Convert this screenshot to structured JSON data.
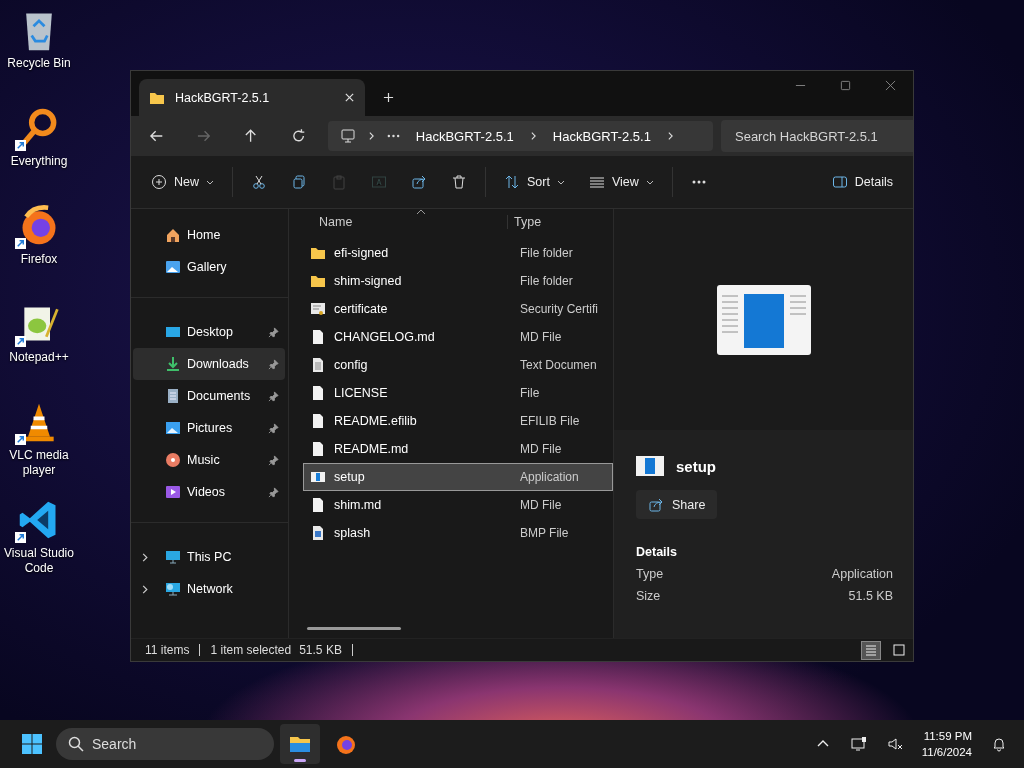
{
  "desktop_icons": [
    {
      "label": "Recycle Bin",
      "kind": "recycle",
      "shortcut": false
    },
    {
      "label": "Everything",
      "kind": "everything",
      "shortcut": true
    },
    {
      "label": "Firefox",
      "kind": "firefox",
      "shortcut": true
    },
    {
      "label": "Notepad++",
      "kind": "notepad",
      "shortcut": true
    },
    {
      "label": "VLC media player",
      "kind": "vlc",
      "shortcut": true
    },
    {
      "label": "Visual Studio Code",
      "kind": "vscode",
      "shortcut": true
    }
  ],
  "window": {
    "tab": {
      "title": "HackBGRT-2.5.1"
    },
    "address": {
      "crumbs": [
        "HackBGRT-2.5.1",
        "HackBGRT-2.5.1"
      ]
    },
    "search": {
      "placeholder": "Search HackBGRT-2.5.1"
    },
    "toolbar": [
      {
        "kind": "new",
        "label": "New",
        "disabled": false
      },
      {
        "kind": "cut",
        "disabled": false
      },
      {
        "kind": "copy",
        "disabled": false
      },
      {
        "kind": "paste",
        "disabled": true
      },
      {
        "kind": "rename",
        "disabled": true
      },
      {
        "kind": "share",
        "disabled": false
      },
      {
        "kind": "delete",
        "disabled": false
      },
      {
        "kind": "sort",
        "label": "Sort",
        "disabled": false
      },
      {
        "kind": "view",
        "label": "View",
        "disabled": false
      },
      {
        "kind": "more",
        "disabled": false
      },
      {
        "kind": "details",
        "label": "Details",
        "disabled": false
      }
    ],
    "sidebar": [
      [
        {
          "label": "Home",
          "kind": "home",
          "pinned": false,
          "selected": false,
          "expandable": false
        },
        {
          "label": "Gallery",
          "kind": "gallery",
          "pinned": false,
          "selected": false,
          "expandable": false
        }
      ],
      [
        {
          "label": "Desktop",
          "kind": "desktop",
          "pinned": true,
          "selected": false,
          "expandable": false
        },
        {
          "label": "Downloads",
          "kind": "downloads",
          "pinned": true,
          "selected": true,
          "expandable": false
        },
        {
          "label": "Documents",
          "kind": "documents",
          "pinned": true,
          "selected": false,
          "expandable": false
        },
        {
          "label": "Pictures",
          "kind": "pictures",
          "pinned": true,
          "selected": false,
          "expandable": false
        },
        {
          "label": "Music",
          "kind": "music",
          "pinned": true,
          "selected": false,
          "expandable": false
        },
        {
          "label": "Videos",
          "kind": "videos",
          "pinned": true,
          "selected": false,
          "expandable": false
        }
      ],
      [
        {
          "label": "This PC",
          "kind": "pc",
          "pinned": false,
          "selected": false,
          "expandable": true
        },
        {
          "label": "Network",
          "kind": "network",
          "pinned": false,
          "selected": false,
          "expandable": true
        }
      ]
    ],
    "columns": [
      "Name",
      "Type"
    ],
    "rows": [
      {
        "name": "efi-signed",
        "type": "File folder",
        "kind": "folder",
        "selected": false
      },
      {
        "name": "shim-signed",
        "type": "File folder",
        "kind": "folder",
        "selected": false
      },
      {
        "name": "certificate",
        "type": "Security Certifi",
        "kind": "certificate",
        "selected": false
      },
      {
        "name": "CHANGELOG.md",
        "type": "MD File",
        "kind": "file",
        "selected": false
      },
      {
        "name": "config",
        "type": "Text Documen",
        "kind": "text",
        "selected": false
      },
      {
        "name": "LICENSE",
        "type": "File",
        "kind": "file",
        "selected": false
      },
      {
        "name": "README.efilib",
        "type": "EFILIB File",
        "kind": "file",
        "selected": false
      },
      {
        "name": "README.md",
        "type": "MD File",
        "kind": "file",
        "selected": false
      },
      {
        "name": "setup",
        "type": "Application",
        "kind": "app",
        "selected": true
      },
      {
        "name": "shim.md",
        "type": "MD File",
        "kind": "file",
        "selected": false
      },
      {
        "name": "splash",
        "type": "BMP File",
        "kind": "image",
        "selected": false
      }
    ],
    "details_pane": {
      "name": "setup",
      "share": "Share",
      "heading": "Details",
      "properties": [
        {
          "label": "Type",
          "value": "Application"
        },
        {
          "label": "Size",
          "value": "51.5 KB"
        }
      ]
    },
    "status_bar": {
      "count": "11 items",
      "selection": "1 item selected",
      "size": "51.5 KB"
    },
    "view_modes": [
      {
        "kind": "details",
        "selected": true
      },
      {
        "kind": "preview",
        "selected": false
      }
    ]
  },
  "taskbar": {
    "search": {
      "placeholder": "Search"
    },
    "apps": [
      {
        "kind": "explorer",
        "selected": true
      },
      {
        "kind": "firefox",
        "selected": false
      }
    ],
    "time": "11:59 PM",
    "date": "11/6/2024"
  }
}
